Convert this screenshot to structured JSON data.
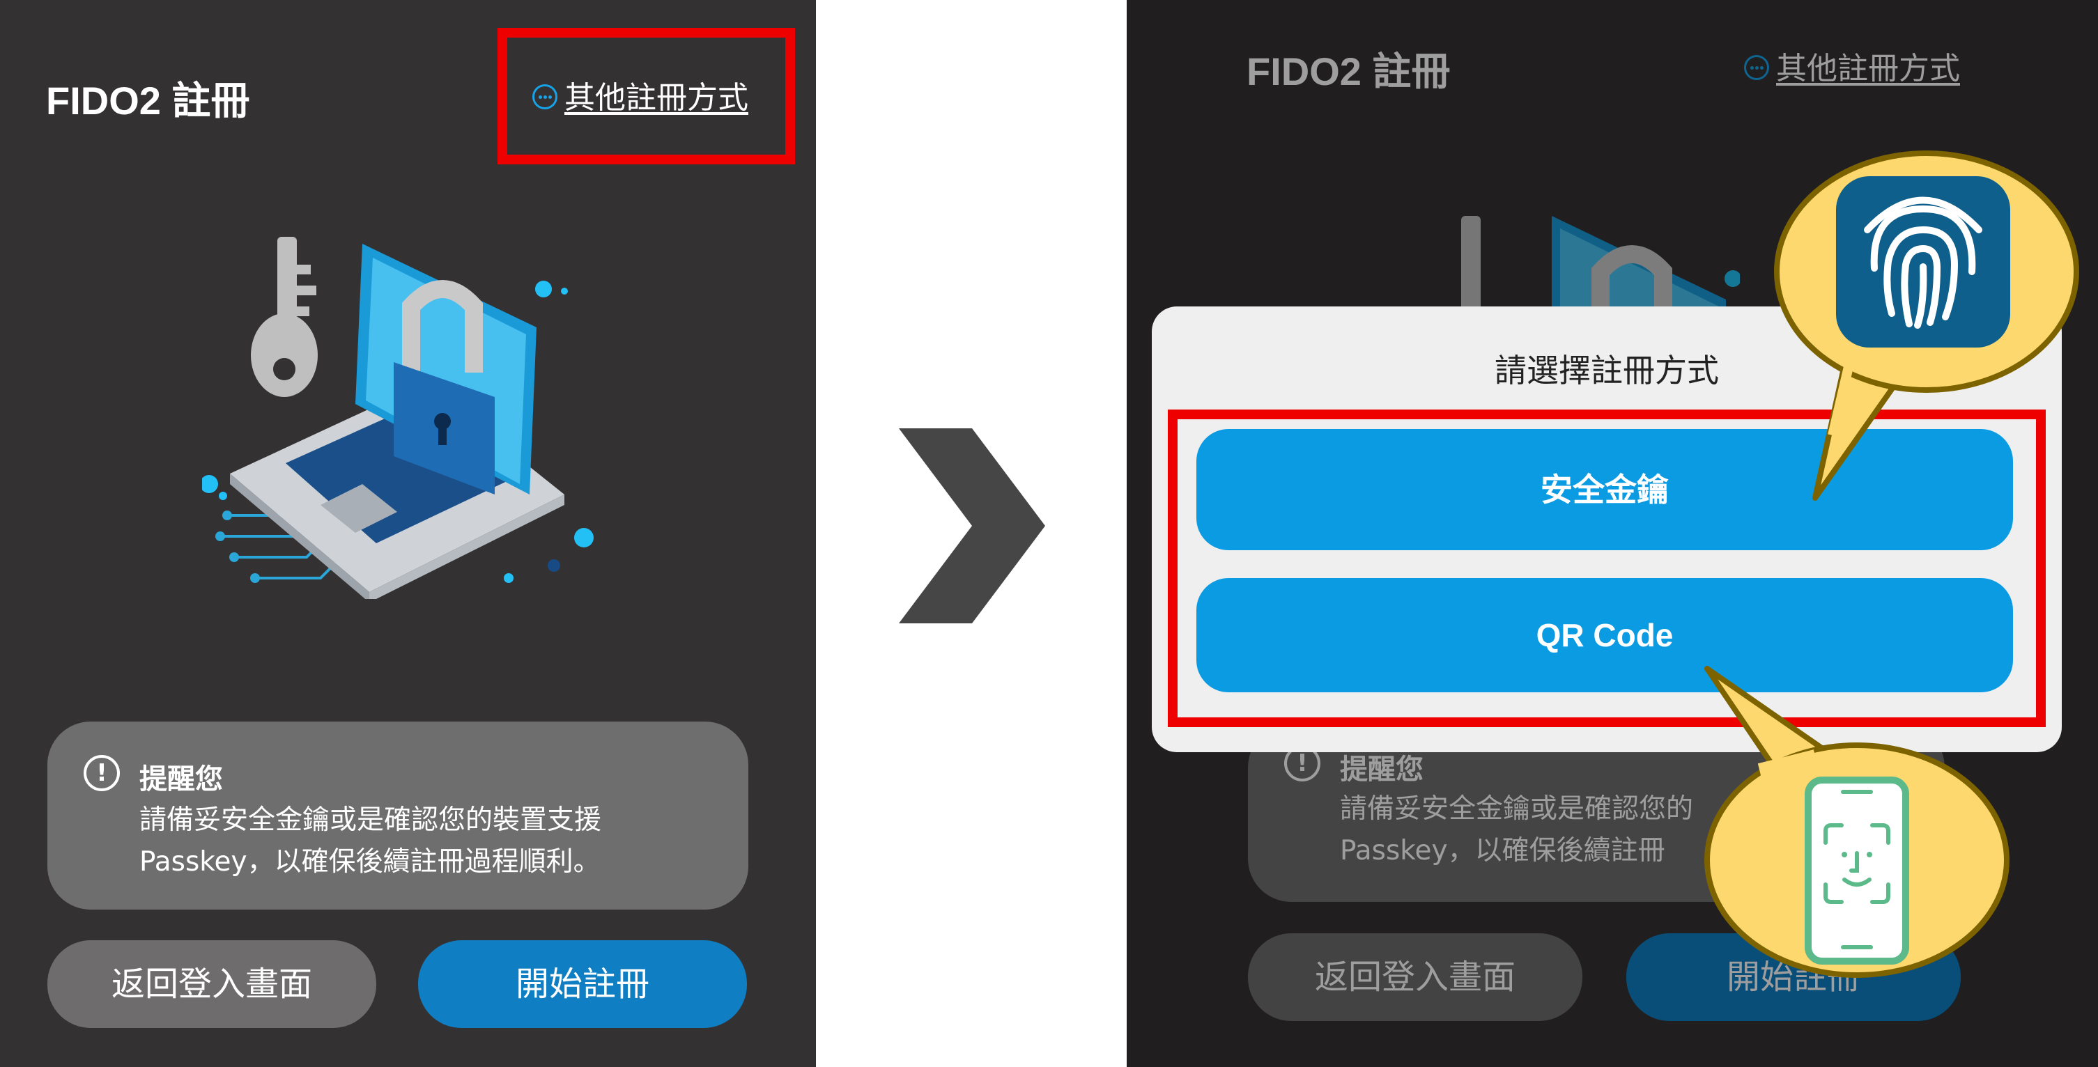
{
  "left": {
    "title": "FIDO2 註冊",
    "other_methods": "其他註冊方式",
    "notice_title": "提醒您",
    "notice_line1": "請備妥安全金鑰或是確認您的裝置支援",
    "notice_line2": "Passkey，以確保後續註冊過程順利。",
    "back_button": "返回登入畫面",
    "start_button": "開始註冊"
  },
  "right": {
    "title": "FIDO2 註冊",
    "other_methods": "其他註冊方式",
    "notice_title": "提醒您",
    "notice_line1": "請備妥安全金鑰或是確認您的",
    "notice_line2": "Passkey，以確保後續註冊",
    "back_button": "返回登入畫面",
    "start_button": "開始註冊",
    "modal": {
      "title": "請選擇註冊方式",
      "options": [
        "安全金鑰",
        "QR Code"
      ]
    }
  },
  "icons": [
    "fido-security-illustration",
    "more-circle-icon",
    "info-icon",
    "next-chevron-icon",
    "fingerprint-icon",
    "face-id-phone-icon"
  ],
  "colors": {
    "panel_bg": "#343132",
    "accent_blue": "#0a9be3",
    "start_button": "#0f7ec2",
    "highlight_red": "#ee0000",
    "callout_yellow": "#fdd86e"
  }
}
